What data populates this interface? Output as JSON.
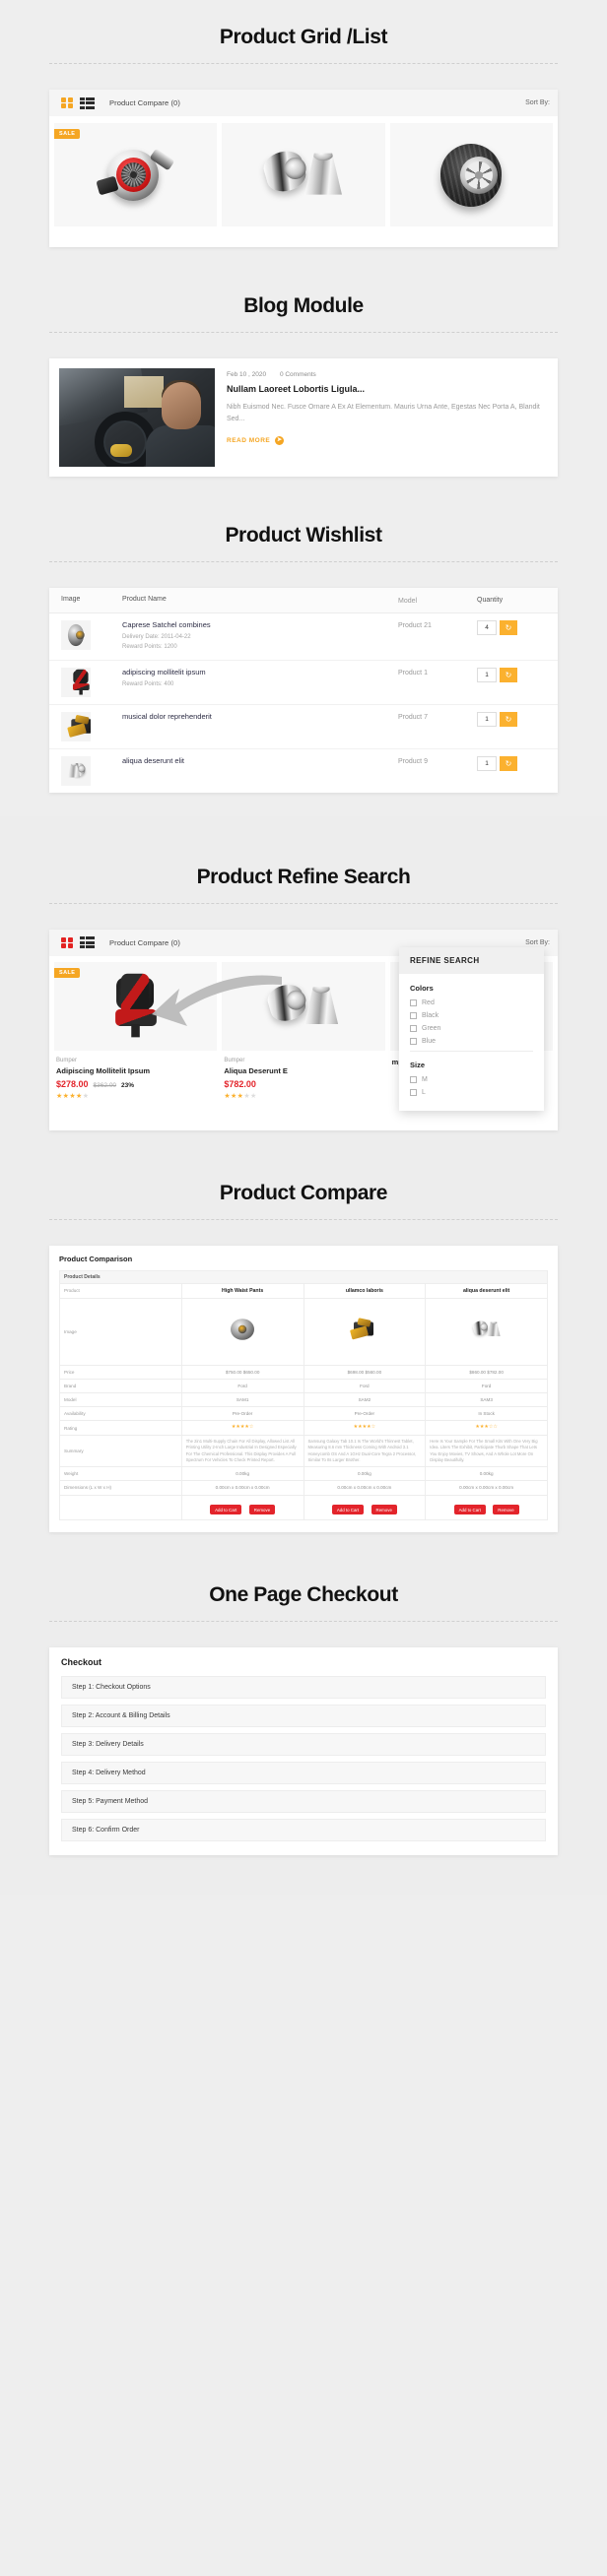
{
  "sections": {
    "grid": {
      "title": "Product Grid /List"
    },
    "blog": {
      "title": "Blog Module"
    },
    "wishlist": {
      "title": "Product Wishlist"
    },
    "refine": {
      "title": "Product Refine Search"
    },
    "compare": {
      "title": "Product Compare"
    },
    "checkout": {
      "title": "One Page Checkout"
    }
  },
  "toolbar": {
    "compare_label": "Product Compare (0)",
    "sort_label": "Sort By:",
    "grid_icon": "grid-view-icon",
    "list_icon": "list-view-icon",
    "accent_orange": "#f5a623",
    "accent_red": "#e32322"
  },
  "grid_products": [
    {
      "badge": "SALE",
      "art": "turbocharger"
    },
    {
      "badge": "",
      "art": "chrome-exhaust-tips"
    },
    {
      "badge": "",
      "art": "alloy-wheel-tyre"
    }
  ],
  "blog": {
    "date": "Feb 10 , 2020",
    "comments": "0 Comments",
    "title": "Nullam Laoreet Lobortis Ligula...",
    "excerpt": "Nibh Euismod Nec. Fusce Ornare A Ex At Elementum. Mauris Urna Ante, Egestas Nec Porta A, Blandit Sed...",
    "read_more": "READ MORE",
    "thumb_alt": "man-detailing-car-interior"
  },
  "wishlist": {
    "columns": [
      "Image",
      "Product Name",
      "Model",
      "Quantity"
    ],
    "rows": [
      {
        "name": "Caprese Satchel combines",
        "sub1": "Delivery Date: 2011-04-22",
        "sub2": "Reward Points: 1200",
        "model": "Product 21",
        "qty": "4",
        "art": "hub-small"
      },
      {
        "name": "adipiscing mollitelit ipsum",
        "sub1": "Reward Points: 400",
        "sub2": "",
        "model": "Product 1",
        "qty": "1",
        "art": "seat"
      },
      {
        "name": "musical dolor reprehenderit",
        "sub1": "",
        "sub2": "",
        "model": "Product 7",
        "qty": "1",
        "art": "engine"
      },
      {
        "name": "aliqua deserunt elit",
        "sub1": "",
        "sub2": "",
        "model": "Product 9",
        "qty": "1",
        "art": "chrome-pair"
      }
    ],
    "refresh_icon": "refresh-cart-icon"
  },
  "refine": {
    "panel_title": "REFINE SEARCH",
    "groups": [
      {
        "label": "Colors",
        "options": [
          "Red",
          "Black",
          "Green",
          "Blue"
        ]
      },
      {
        "label": "Size",
        "options": [
          "M",
          "L"
        ]
      }
    ],
    "products": [
      {
        "category": "Bumper",
        "name": "Adipiscing Mollitelit Ipsum",
        "price": "$278.00",
        "old_price": "$362.00",
        "discount": "23%",
        "rating": 4,
        "art": "seat"
      },
      {
        "category": "Bumper",
        "name": "Aliqua Deserunt E",
        "price": "$782.00",
        "old_price": "",
        "discount": "",
        "rating": 3,
        "art": "chrome-pair"
      },
      {
        "category": "",
        "name": "mpos",
        "price": "",
        "old_price": "",
        "discount": "",
        "rating": 0,
        "art": "tyre"
      }
    ]
  },
  "compare": {
    "heading": "Product Comparison",
    "details_label": "Product Details",
    "row_labels": [
      "Product",
      "Image",
      "Price",
      "Brand",
      "Model",
      "Availability",
      "Rating",
      "Summary",
      "Weight",
      "Dimensions (L x W x H)"
    ],
    "columns": [
      {
        "name": "High Waist Pants",
        "price_old": "$750.00",
        "price_new": "$650.00",
        "brand": "Ford",
        "model": "SAM1",
        "availability": "Pre-Order",
        "rating": 4,
        "summary": "The 2in1 Multi-Supply Chain For All Display, Allowed List All Printing Utility 2-Inch Large Industrial In Designed Especially For The Chemical Professional. This Display Provides A Full Spectrum For Vehicles To Check Printed Report.",
        "weight": "0.00kg",
        "dimensions": "0.00cm x 0.00cm x 0.00cm",
        "art": "hub-small"
      },
      {
        "name": "ullamco laboris",
        "price_old": "$698.00",
        "price_new": "$560.00",
        "brand": "Ford",
        "model": "SAM2",
        "availability": "Pre-Order",
        "rating": 4,
        "summary": "Samsung Galaxy Tab 10.1 Is The World's Thinnest Tablet, Measuring 8.6 mm Thickness Coming With Android 3.1 Honeycomb OS And A 1GHz Dual-Core Tegra 2 Processor, Similar To Its Larger Brother.",
        "weight": "0.00kg",
        "dimensions": "0.00cm x 0.00cm x 0.00cm",
        "art": "engine"
      },
      {
        "name": "aliqua deserunt elit",
        "price_old": "$860.00",
        "price_new": "$782.00",
        "brand": "Ford",
        "model": "SAM3",
        "availability": "In Stock",
        "rating": 3,
        "summary": "Here Is Your Sample For The Small Kits With One Very Big Idea. Liters The Exhibit, Participate Thurb Shape That Lets You Enjoy Movies, TV Shows, And A Whole Lot More On Display Beautifully.",
        "weight": "0.00kg",
        "dimensions": "0.00cm x 0.00cm x 0.00cm",
        "art": "chrome-pair"
      }
    ],
    "add_to_cart_label": "Add to Cart",
    "remove_label": "Remove"
  },
  "checkout": {
    "heading": "Checkout",
    "steps": [
      "Step 1: Checkout Options",
      "Step 2: Account & Billing Details",
      "Step 3: Delivery Details",
      "Step 4: Delivery Method",
      "Step 5: Payment Method",
      "Step 6: Confirm Order"
    ]
  }
}
